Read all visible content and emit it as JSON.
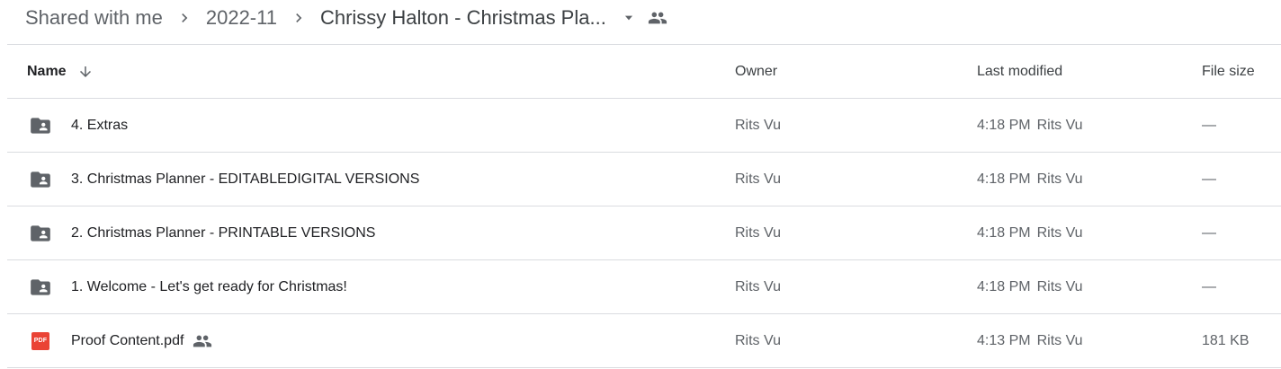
{
  "breadcrumb": {
    "items": [
      "Shared with me",
      "2022-11"
    ],
    "current": "Chrissy Halton - Christmas Pla..."
  },
  "columns": {
    "name": "Name",
    "owner": "Owner",
    "last_modified": "Last modified",
    "file_size": "File size"
  },
  "rows": [
    {
      "name": "4. Extras",
      "owner": "Rits Vu",
      "time": "4:18 PM",
      "by": "Rits Vu",
      "size": "—",
      "type": "shared-folder"
    },
    {
      "name": "3. Christmas Planner - EDITABLEDIGITAL VERSIONS",
      "owner": "Rits Vu",
      "time": "4:18 PM",
      "by": "Rits Vu",
      "size": "—",
      "type": "shared-folder"
    },
    {
      "name": "2. Christmas Planner - PRINTABLE VERSIONS",
      "owner": "Rits Vu",
      "time": "4:18 PM",
      "by": "Rits Vu",
      "size": "—",
      "type": "shared-folder"
    },
    {
      "name": "1. Welcome - Let's get ready for Christmas!",
      "owner": "Rits Vu",
      "time": "4:18 PM",
      "by": "Rits Vu",
      "size": "—",
      "type": "shared-folder"
    },
    {
      "name": "Proof Content.pdf",
      "owner": "Rits Vu",
      "time": "4:13 PM",
      "by": "Rits Vu",
      "size": "181 KB",
      "type": "pdf",
      "pdf_badge": "PDF"
    }
  ],
  "colors": {
    "pdf": "#ea4335",
    "icon": "#5f6368",
    "divider": "#dadce0"
  }
}
